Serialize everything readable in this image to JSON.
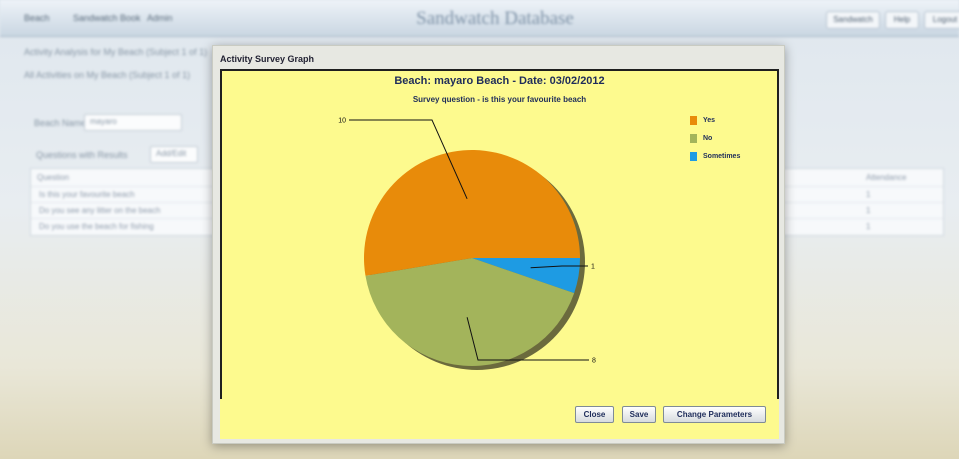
{
  "app": {
    "title": "Sandwatch Database",
    "nav": [
      "Beach",
      "Sandwatch Book",
      "Admin"
    ],
    "top_buttons": [
      "Sandwatch",
      "Help",
      "Logout"
    ]
  },
  "background": {
    "crumb1": "Activity Analysis for My Beach (Subject 1 of 1)",
    "crumb2": "All Activities on My Beach (Subject 1 of 1)",
    "filter_label": "Beach Name",
    "filter_value": "mayaro",
    "tab_label": "Questions with Results",
    "tab_button": "Add/Edit",
    "table_header_left": "Question",
    "table_header_right": "Attendance",
    "rows": [
      {
        "q": "Is this your favourite beach",
        "v": "1"
      },
      {
        "q": "Do you see any litter on the beach",
        "v": "1"
      },
      {
        "q": "Do you use the beach for fishing",
        "v": "1"
      }
    ]
  },
  "dialog": {
    "title": "Activity Survey Graph",
    "buttons": {
      "close": "Close",
      "save": "Save",
      "change": "Change Parameters"
    }
  },
  "chart_data": {
    "type": "pie",
    "title": "Beach: mayaro Beach  - Date: 03/02/2012",
    "subtitle": "Survey question - is this your favourite beach",
    "categories": [
      "Yes",
      "No",
      "Sometimes"
    ],
    "values": [
      10,
      8,
      1
    ],
    "colors": [
      "#e88b0a",
      "#a3b45b",
      "#1e9be3"
    ],
    "legend_position": "top-right"
  }
}
